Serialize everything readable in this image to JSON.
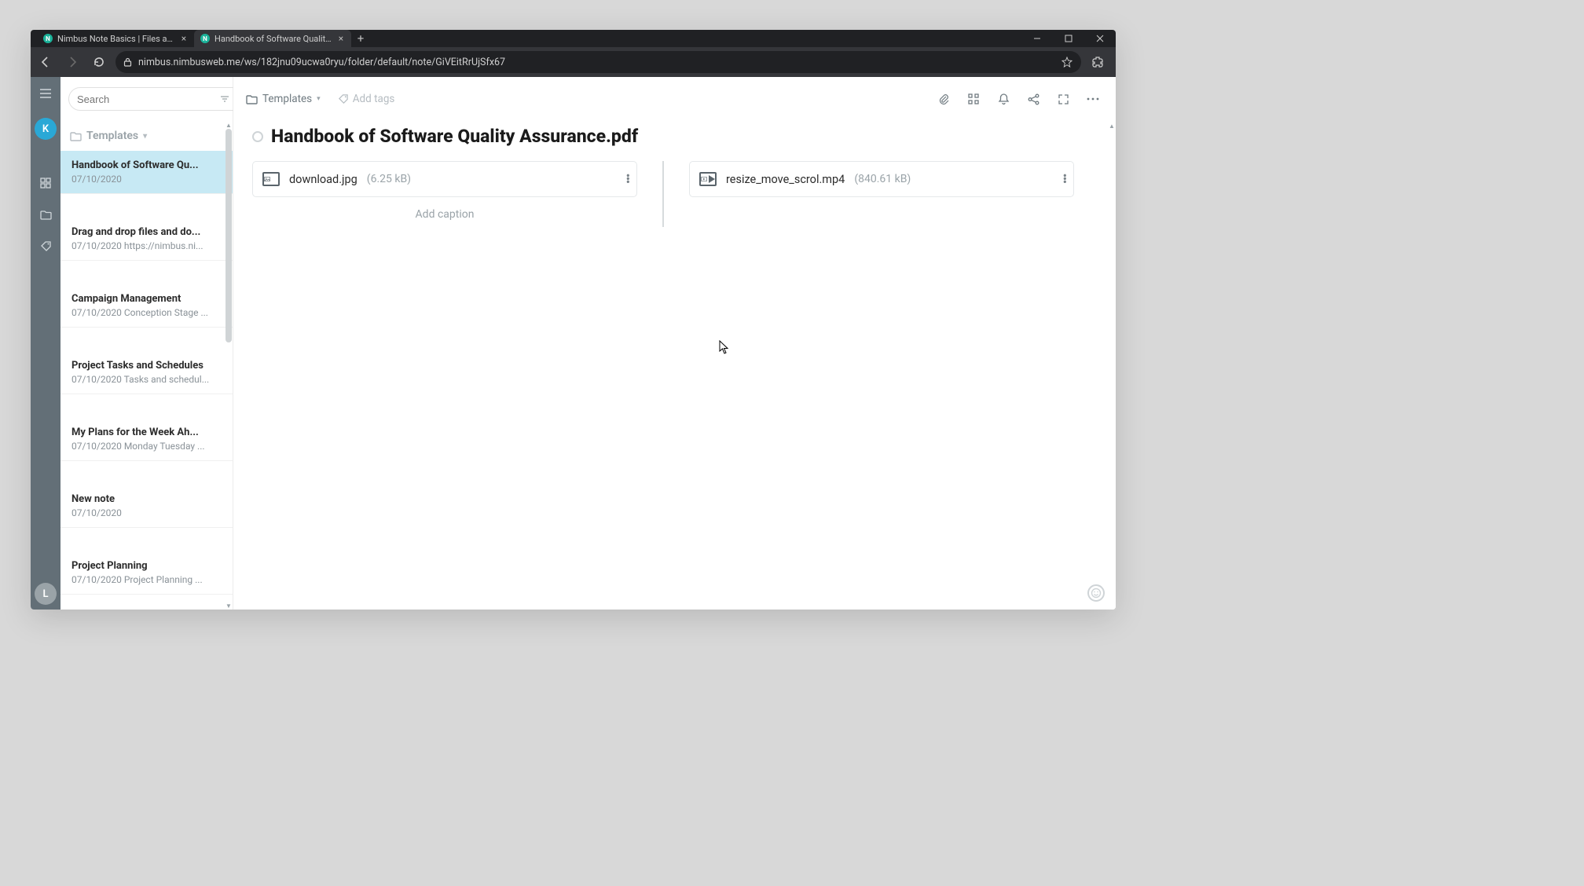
{
  "browser": {
    "tabs": [
      {
        "title": "Nimbus Note Basics | Files and a",
        "favicon": "N",
        "active": false
      },
      {
        "title": "Handbook of Software Quality A",
        "favicon": "N",
        "active": true
      }
    ],
    "url": "nimbus.nimbusweb.me/ws/182jnu09ucwa0ryu/folder/default/note/GiVEitRrUjSfx67"
  },
  "rail": {
    "avatar_top": "K",
    "avatar_bottom": "L"
  },
  "sidebar": {
    "search_placeholder": "Search",
    "header_label": "Templates",
    "notes": [
      {
        "title": "Handbook of Software Qu...",
        "sub": "07/10/2020",
        "selected": true,
        "gap": true
      },
      {
        "title": "Drag and drop files and do...",
        "sub": "07/10/2020 https://nimbus.ni...",
        "selected": false,
        "gap": true
      },
      {
        "title": "Campaign Management",
        "sub": "07/10/2020 Conception Stage ...",
        "selected": false,
        "gap": true
      },
      {
        "title": "Project Tasks and Schedules",
        "sub": "07/10/2020 Tasks and schedul...",
        "selected": false,
        "gap": true
      },
      {
        "title": "My Plans for the Week Ah...",
        "sub": "07/10/2020 Monday Tuesday ...",
        "selected": false,
        "gap": true
      },
      {
        "title": "New note",
        "sub": "07/10/2020",
        "selected": false,
        "gap": true
      },
      {
        "title": "Project Planning",
        "sub": "07/10/2020 Project Planning ...",
        "selected": false,
        "gap": false
      }
    ]
  },
  "topbar": {
    "breadcrumb": "Templates",
    "addtags": "Add tags"
  },
  "doc": {
    "title": "Handbook of Software Quality Assurance.pdf",
    "attachments": [
      {
        "name": "download.jpg",
        "size": "(6.25 kB)",
        "kind": "image",
        "caption": "Add caption"
      },
      {
        "name": "resize_move_scrol.mp4",
        "size": "(840.61 kB)",
        "kind": "video",
        "caption": ""
      }
    ]
  }
}
